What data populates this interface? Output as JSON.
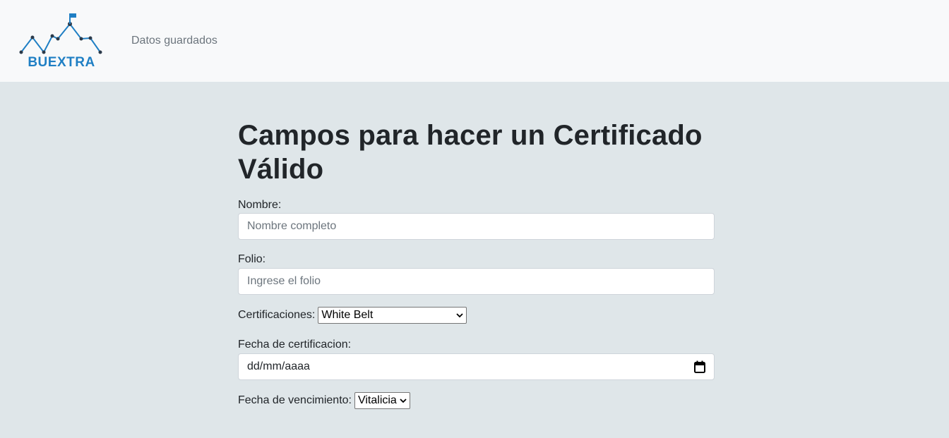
{
  "navbar": {
    "logo_text": "BUEXTRA",
    "link_label": "Datos guardados"
  },
  "form": {
    "title": "Campos para hacer un Certificado Válido",
    "nombre": {
      "label": "Nombre:",
      "placeholder": "Nombre completo",
      "value": ""
    },
    "folio": {
      "label": "Folio:",
      "placeholder": "Ingrese el folio",
      "value": ""
    },
    "certificaciones": {
      "label": "Certificaciones:",
      "selected": "White Belt"
    },
    "fecha_certificacion": {
      "label": "Fecha de certificacion:",
      "placeholder": "dd/mm/aaaa",
      "icon": "calendar-icon"
    },
    "fecha_vencimiento": {
      "label": "Fecha de vencimiento:",
      "selected": "Vitalicia"
    }
  },
  "colors": {
    "navbar_bg": "#f8f9fa",
    "page_bg": "#dfe6e9",
    "logo_blue": "#1f7fc4"
  }
}
